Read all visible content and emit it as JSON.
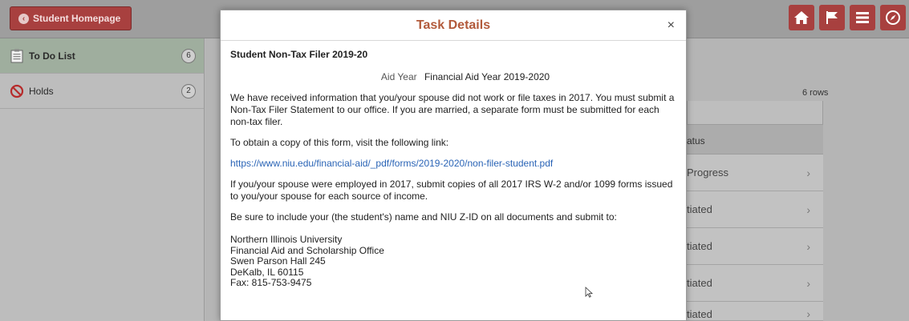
{
  "header": {
    "home_label": "Student Homepage",
    "icons": [
      "home-icon",
      "flag-icon",
      "menu-icon",
      "compass-icon"
    ],
    "accent": "#a8403f"
  },
  "sidebar": {
    "items": [
      {
        "label": "To Do List",
        "count": "6",
        "icon": "checklist-icon"
      },
      {
        "label": "Holds",
        "count": "2",
        "icon": "no-entry-icon"
      }
    ]
  },
  "table": {
    "rows_count": "6 rows",
    "status_header": "atus",
    "rows": [
      "Progress",
      "tiated",
      "tiated",
      "tiated",
      "tiated"
    ]
  },
  "modal": {
    "title": "Task Details",
    "close_label": "×",
    "task_name": "Student Non-Tax Filer 2019-20",
    "aid_year_label": "Aid Year",
    "aid_year_value": "Financial Aid Year 2019-2020",
    "para1": "We have received information that you/your spouse did not work or file taxes in 2017. You must submit a Non-Tax Filer Statement to our office. If you are married, a separate form must be submitted for each non-tax filer.",
    "para2": "To obtain a copy of this form, visit the following link:",
    "link": "https://www.niu.edu/financial-aid/_pdf/forms/2019-2020/non-filer-student.pdf",
    "para3": "If you/your spouse were employed in 2017, submit copies of all 2017 IRS W-2 and/or 1099 forms issued to you/your spouse for each source of income.",
    "para4": "Be sure to include your (the student's) name and NIU Z-ID on all documents and submit to:",
    "address": [
      "Northern Illinois University",
      "Financial Aid and Scholarship Office",
      "Swen Parson Hall 245",
      "DeKalb, IL  60115",
      "Fax: 815-753-9475"
    ],
    "title_color": "#b25a3b",
    "link_color": "#2a64b6"
  }
}
